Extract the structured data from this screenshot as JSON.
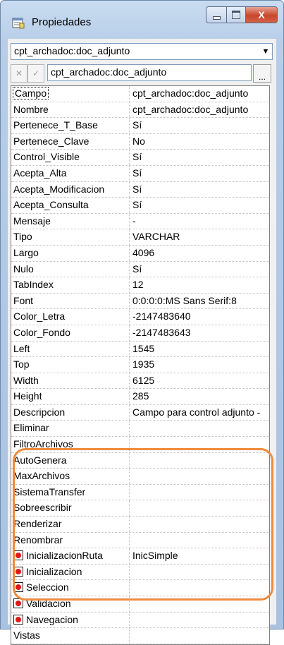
{
  "window": {
    "title": "Propiedades",
    "title_icon": "properties-icon",
    "minimize_icon": "minimize-icon",
    "maximize_icon": "maximize-icon",
    "close_icon": "close-icon",
    "close_glyph": "X"
  },
  "selector": {
    "value": "cpt_archadoc:doc_adjunto",
    "arrow_glyph": "▼"
  },
  "editbar": {
    "cancel_glyph": "✕",
    "ok_glyph": "✓",
    "value": "cpt_archadoc:doc_adjunto",
    "browse_label": "..."
  },
  "colors": {
    "highlight": "#f08a3c",
    "event_icon": "#e01818"
  },
  "properties": [
    {
      "name": "Campo",
      "value": "cpt_archadoc:doc_adjunto"
    },
    {
      "name": "Nombre",
      "value": "cpt_archadoc:doc_adjunto"
    },
    {
      "name": "Pertenece_T_Base",
      "value": "Sí"
    },
    {
      "name": "Pertenece_Clave",
      "value": "No"
    },
    {
      "name": "Control_Visible",
      "value": "Sí"
    },
    {
      "name": "Acepta_Alta",
      "value": "Sí"
    },
    {
      "name": "Acepta_Modificacion",
      "value": "Sí"
    },
    {
      "name": "Acepta_Consulta",
      "value": "Sí"
    },
    {
      "name": "Mensaje",
      "value": "-"
    },
    {
      "name": "Tipo",
      "value": "VARCHAR"
    },
    {
      "name": "Largo",
      "value": "4096"
    },
    {
      "name": "Nulo",
      "value": "Sí"
    },
    {
      "name": "TabIndex",
      "value": "12"
    },
    {
      "name": "Font",
      "value": "0:0:0:0:MS Sans Serif:8"
    },
    {
      "name": "Color_Letra",
      "value": "-2147483640"
    },
    {
      "name": "Color_Fondo",
      "value": "-2147483643"
    },
    {
      "name": "Left",
      "value": "1545"
    },
    {
      "name": "Top",
      "value": "1935"
    },
    {
      "name": "Width",
      "value": "6125"
    },
    {
      "name": "Height",
      "value": "285"
    },
    {
      "name": "Descripcion",
      "value": "Campo para control adjunto -"
    },
    {
      "name": "Eliminar",
      "value": ""
    },
    {
      "name": "FiltroArchivos",
      "value": ""
    },
    {
      "name": "AutoGenera",
      "value": ""
    },
    {
      "name": "MaxArchivos",
      "value": ""
    },
    {
      "name": "SistemaTransfer",
      "value": ""
    },
    {
      "name": "Sobreescribir",
      "value": ""
    },
    {
      "name": "Renderizar",
      "value": ""
    },
    {
      "name": "Renombrar",
      "value": ""
    },
    {
      "name": "InicializacionRuta",
      "value": "InicSimple"
    },
    {
      "name": "Inicializacion",
      "value": ""
    },
    {
      "name": "Seleccion",
      "value": ""
    },
    {
      "name": "Validacion",
      "value": ""
    },
    {
      "name": "Navegacion",
      "value": ""
    },
    {
      "name": "Vistas",
      "value": ""
    }
  ]
}
